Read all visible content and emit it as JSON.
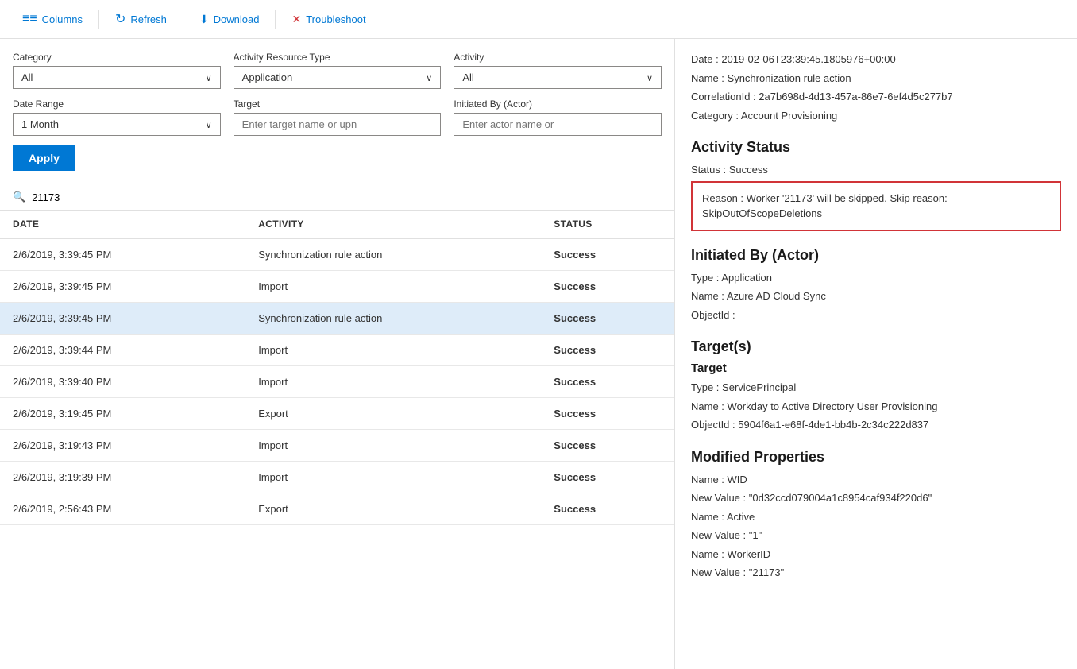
{
  "toolbar": {
    "columns_label": "Columns",
    "refresh_label": "Refresh",
    "download_label": "Download",
    "troubleshoot_label": "Troubleshoot"
  },
  "filters": {
    "category_label": "Category",
    "category_value": "All",
    "activity_resource_type_label": "Activity Resource Type",
    "activity_resource_type_value": "Application",
    "activity_label": "Activity",
    "activity_value": "All",
    "date_range_label": "Date Range",
    "date_range_value": "1 Month",
    "target_label": "Target",
    "target_placeholder": "Enter target name or upn",
    "initiated_by_label": "Initiated By (Actor)",
    "initiated_by_placeholder": "Enter actor name or",
    "apply_label": "Apply"
  },
  "search": {
    "placeholder": "21173",
    "value": "21173"
  },
  "table": {
    "col_date": "DATE",
    "col_activity": "ACTIVITY",
    "col_status": "STATUS",
    "rows": [
      {
        "date": "2/6/2019, 3:39:45 PM",
        "activity": "Synchronization rule action",
        "status": "Success",
        "selected": false
      },
      {
        "date": "2/6/2019, 3:39:45 PM",
        "activity": "Import",
        "status": "Success",
        "selected": false
      },
      {
        "date": "2/6/2019, 3:39:45 PM",
        "activity": "Synchronization rule action",
        "status": "Success",
        "selected": true
      },
      {
        "date": "2/6/2019, 3:39:44 PM",
        "activity": "Import",
        "status": "Success",
        "selected": false
      },
      {
        "date": "2/6/2019, 3:39:40 PM",
        "activity": "Import",
        "status": "Success",
        "selected": false
      },
      {
        "date": "2/6/2019, 3:19:45 PM",
        "activity": "Export",
        "status": "Success",
        "selected": false
      },
      {
        "date": "2/6/2019, 3:19:43 PM",
        "activity": "Import",
        "status": "Success",
        "selected": false
      },
      {
        "date": "2/6/2019, 3:19:39 PM",
        "activity": "Import",
        "status": "Success",
        "selected": false
      },
      {
        "date": "2/6/2019, 2:56:43 PM",
        "activity": "Export",
        "status": "Success",
        "selected": false
      }
    ]
  },
  "detail": {
    "top_info": {
      "date_label": "Date :",
      "date_value": "2019-02-06T23:39:45.1805976+00:00",
      "name_label": "Name :",
      "name_value": "Synchronization rule action",
      "correlation_label": "CorrelationId :",
      "correlation_value": "2a7b698d-4d13-457a-86e7-6ef4d5c277b7",
      "category_label": "Category :",
      "category_value": "Account Provisioning"
    },
    "activity_status": {
      "heading": "Activity Status",
      "status_label": "Status :",
      "status_value": "Success",
      "reason_label": "Reason :",
      "reason_value": "Worker '21173' will be skipped. Skip reason: SkipOutOfScopeDeletions"
    },
    "initiated_by": {
      "heading": "Initiated By (Actor)",
      "type_label": "Type :",
      "type_value": "Application",
      "name_label": "Name :",
      "name_value": "Azure AD Cloud Sync",
      "objectid_label": "ObjectId :",
      "objectid_value": ""
    },
    "targets": {
      "heading": "Target(s)",
      "target_heading": "Target",
      "type_label": "Type :",
      "type_value": "ServicePrincipal",
      "name_label": "Name :",
      "name_value": "Workday to Active Directory User Provisioning",
      "objectid_label": "ObjectId :",
      "objectid_value": "5904f6a1-e68f-4de1-bb4b-2c34c222d837"
    },
    "modified_properties": {
      "heading": "Modified Properties",
      "prop1_name": "Name :",
      "prop1_name_value": "WID",
      "prop1_newval": "New Value :",
      "prop1_newval_value": "\"0d32ccd079004a1c8954caf934f220d6\"",
      "prop2_name": "Name :",
      "prop2_name_value": "Active",
      "prop2_newval": "New Value :",
      "prop2_newval_value": "\"1\"",
      "prop3_name": "Name :",
      "prop3_name_value": "WorkerID",
      "prop3_newval": "New Value :",
      "prop3_newval_value": "\"21173\""
    }
  }
}
